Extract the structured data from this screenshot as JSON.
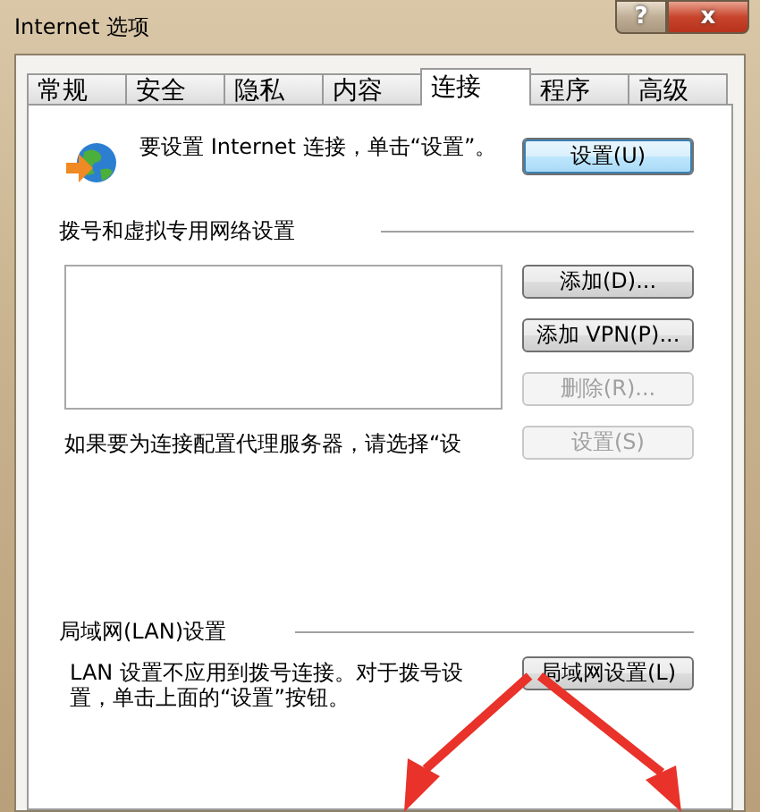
{
  "window": {
    "title": "Internet 选项",
    "help_button": "?",
    "close_button": "x"
  },
  "tabs": [
    {
      "label": "常规",
      "selected": false
    },
    {
      "label": "安全",
      "selected": false
    },
    {
      "label": "隐私",
      "selected": false
    },
    {
      "label": "内容",
      "selected": false
    },
    {
      "label": "连接",
      "selected": true
    },
    {
      "label": "程序",
      "selected": false
    },
    {
      "label": "高级",
      "selected": false
    }
  ],
  "setup": {
    "text": "要设置 Internet 连接，单击“设置”。",
    "button": {
      "label": "设置(U)",
      "disabled": false
    }
  },
  "dialup": {
    "heading": "拨号和虚拟专用网络设置",
    "buttons": [
      {
        "label": "添加(D)...",
        "disabled": false
      },
      {
        "label": "添加 VPN(P)...",
        "disabled": false
      },
      {
        "label": "删除(R)...",
        "disabled": true
      }
    ],
    "proxy_text": "如果要为连接配置代理服务器，请选择“设",
    "proxy_button": {
      "label": "设置(S)",
      "disabled": true
    }
  },
  "lan": {
    "heading": "局域网(LAN)设置",
    "text": "LAN 设置不应用到拨号连接。对于拨号设置，单击上面的“设置”按钮。",
    "button": {
      "label": "局域网设置(L)",
      "disabled": false
    }
  }
}
